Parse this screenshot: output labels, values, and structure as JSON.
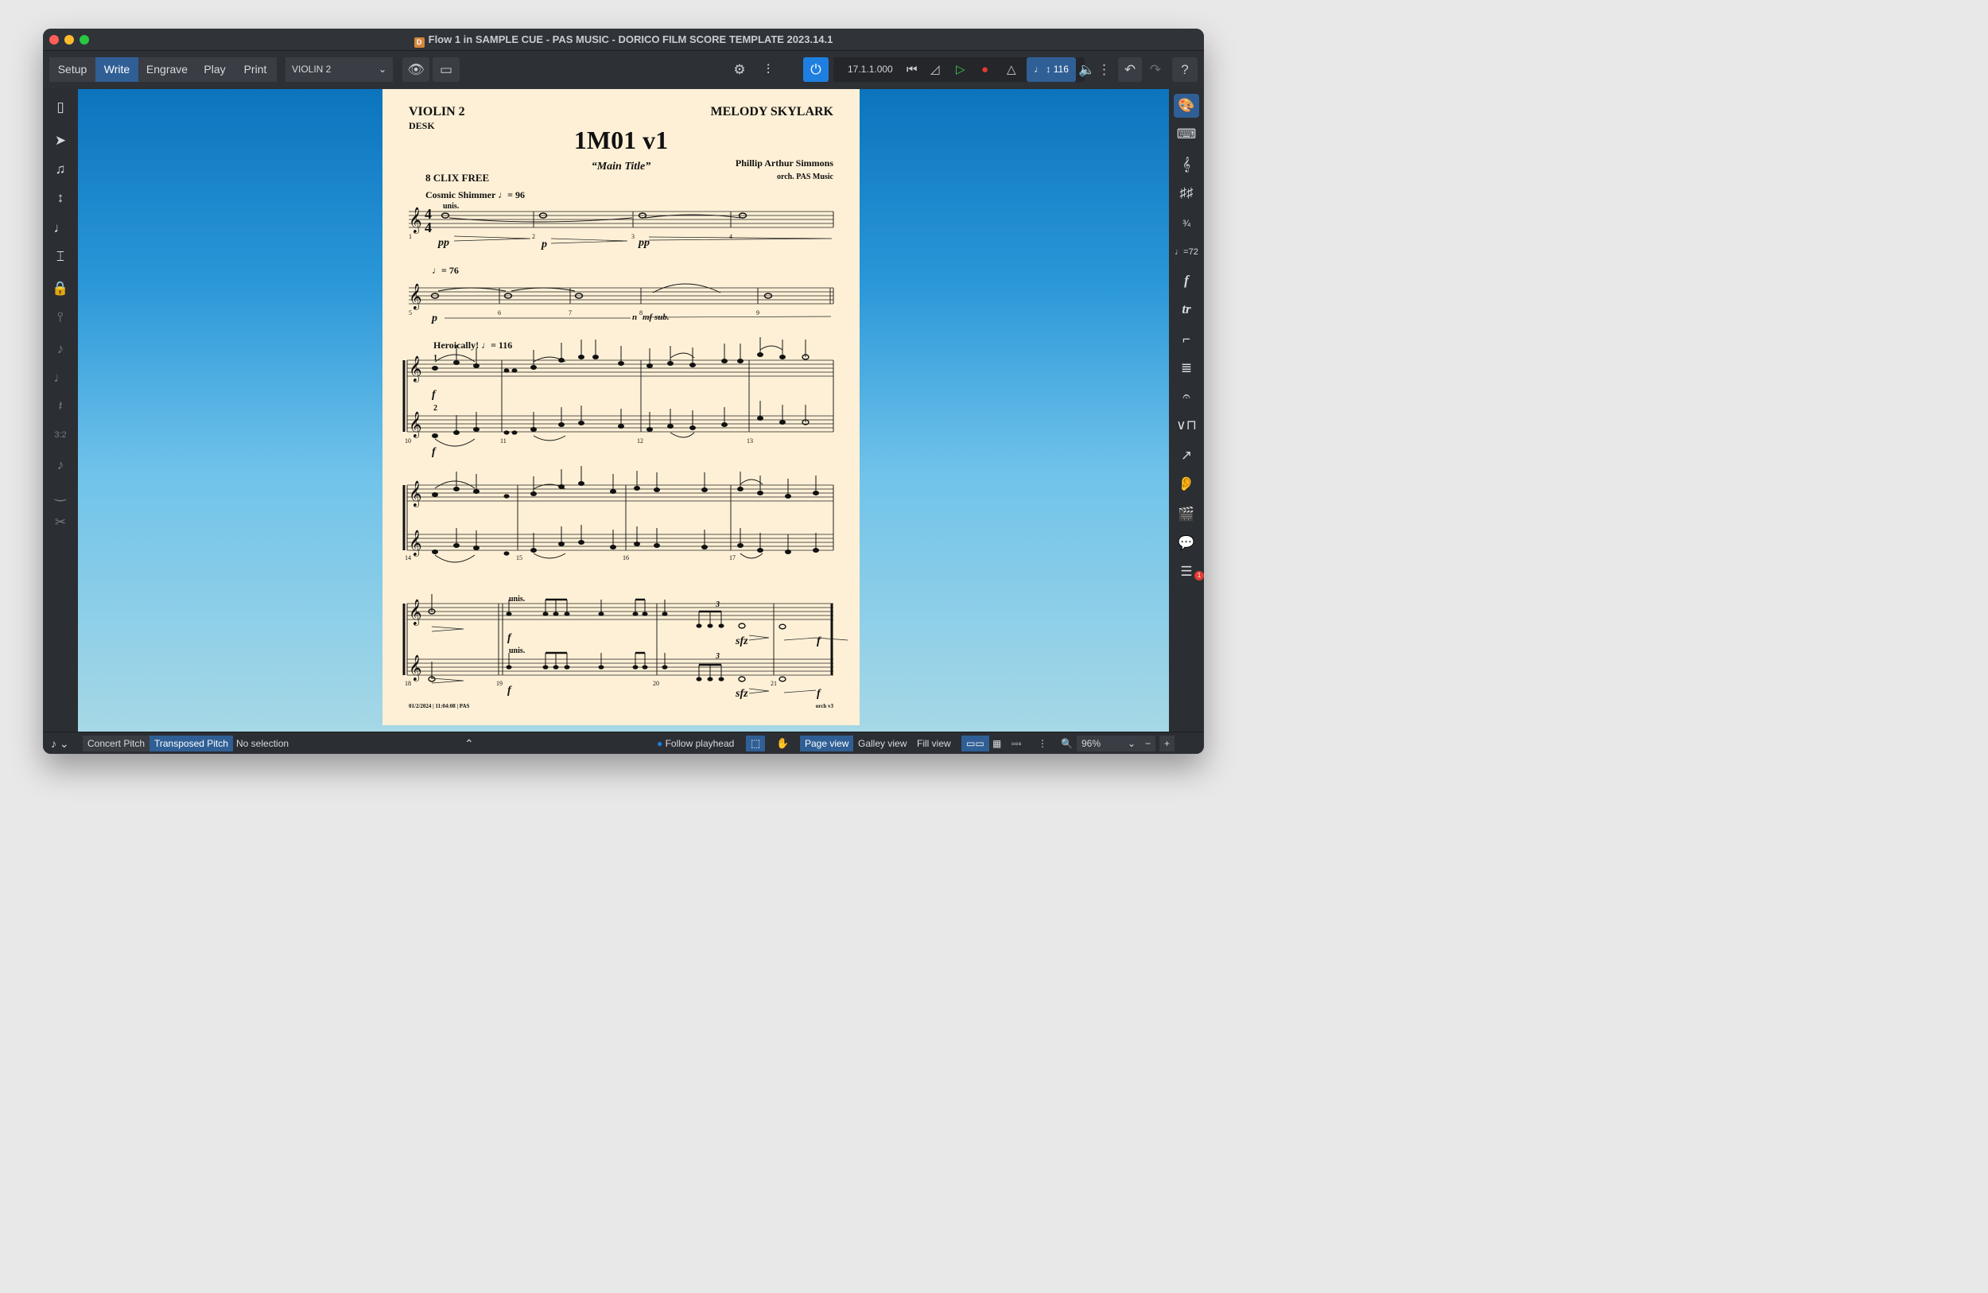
{
  "window": {
    "title": "Flow 1 in SAMPLE CUE - PAS MUSIC - DORICO FILM SCORE TEMPLATE 2023.14.1"
  },
  "modes": [
    "Setup",
    "Write",
    "Engrave",
    "Play",
    "Print"
  ],
  "active_mode": "Write",
  "layout_picker": {
    "value": "VIOLIN 2"
  },
  "transport": {
    "timecode": "17.1.1.000",
    "tempo": "116"
  },
  "score_page": {
    "part_name": "VIOLIN 2",
    "desk": "DESK",
    "composer_header": "MELODY SKYLARK",
    "cue_title": "1M01 v1",
    "subtitle": "“Main Title”",
    "composer": "Phillip Arthur Simmons",
    "orchestrator": "orch. PAS Music",
    "clix": "8 CLIX FREE",
    "tempo1_text": "Cosmic Shimmer",
    "tempo1_bpm": "= 96",
    "unis1": "unis.",
    "tempo2_bpm": "= 76",
    "tempo3_text": "Heroically!",
    "tempo3_bpm": "= 116",
    "divisi1": "1",
    "divisi2": "2",
    "unis2": "unis.",
    "unis3": "unis.",
    "dyn_pp": "pp",
    "dyn_p": "p",
    "dyn_n": "n",
    "dyn_mf_sub": "mf sub.",
    "dyn_f": "f",
    "dyn_sfz": "sfz",
    "triplet": "3",
    "bar_numbers": [
      "1",
      "2",
      "3",
      "4",
      "5",
      "6",
      "7",
      "8",
      "9",
      "10",
      "11",
      "12",
      "13",
      "14",
      "15",
      "16",
      "17",
      "18",
      "19",
      "20",
      "21"
    ],
    "footer_left": "01/2/2024 | 11:04:08 | PAS",
    "footer_right": "orch v3"
  },
  "statusbar": {
    "concert_pitch": "Concert Pitch",
    "transposed_pitch": "Transposed Pitch",
    "selection": "No selection",
    "follow_playhead": "Follow playhead",
    "page_view": "Page view",
    "galley_view": "Galley view",
    "fill_view": "Fill view",
    "zoom": "96%"
  },
  "notifications": {
    "count": "1"
  },
  "icons": {
    "left": [
      "toggle-panel-icon",
      "select-arrow-icon",
      "note-input-icon",
      "pitch-edit-icon",
      "chord-icon",
      "insert-mode-icon",
      "lock-icon",
      "caret-icon",
      "note-add-icon",
      "note-duration-icon",
      "rest-icon",
      "tuplet-icon",
      "grace-note-icon",
      "tie-icon",
      "scissors-icon"
    ],
    "right": [
      "palette-icon",
      "keyboard-icon",
      "clef-icon",
      "key-signature-icon",
      "time-signature-icon",
      "tempo-icon",
      "dynamics-icon",
      "ornaments-icon",
      "repeat-endings-icon",
      "bars-barlines-icon",
      "holds-pauses-icon",
      "playing-techniques-icon",
      "lines-icon",
      "ear-icon",
      "video-icon",
      "comments-icon",
      "tasks-icon"
    ]
  },
  "colors": {
    "accent": "#2f5f95",
    "paper": "#fdf0d6",
    "chrome": "#2b2e33"
  }
}
